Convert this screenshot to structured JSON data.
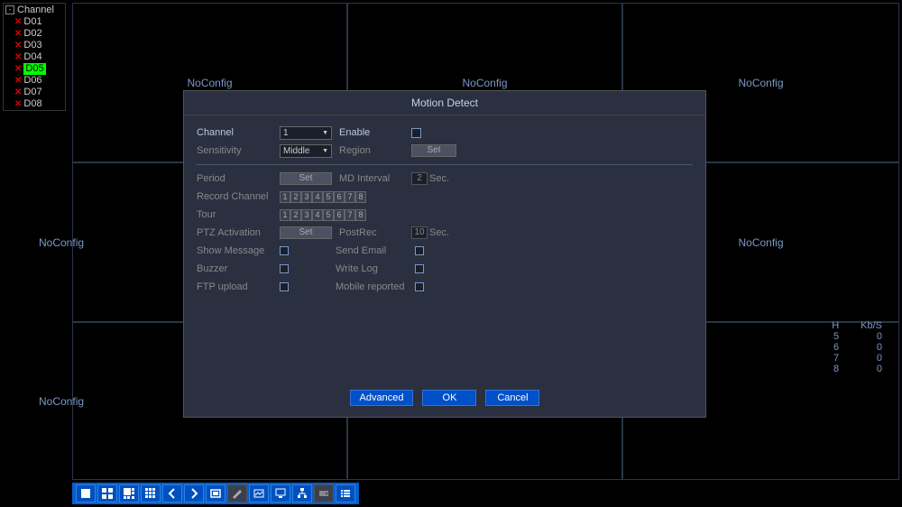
{
  "sidebar": {
    "title": "Channel",
    "items": [
      {
        "label": "D01",
        "selected": false
      },
      {
        "label": "D02",
        "selected": false
      },
      {
        "label": "D03",
        "selected": false
      },
      {
        "label": "D04",
        "selected": false
      },
      {
        "label": "D05",
        "selected": true
      },
      {
        "label": "D06",
        "selected": false
      },
      {
        "label": "D07",
        "selected": false
      },
      {
        "label": "D08",
        "selected": false
      }
    ]
  },
  "grid": {
    "noconfig": "NoConfig"
  },
  "stats": {
    "headers": [
      "H",
      "Kb/S"
    ],
    "rows": [
      {
        "ch": "5",
        "kbps": "0"
      },
      {
        "ch": "6",
        "kbps": "0"
      },
      {
        "ch": "7",
        "kbps": "0"
      },
      {
        "ch": "8",
        "kbps": "0"
      }
    ]
  },
  "dialog": {
    "title": "Motion Detect",
    "labels": {
      "channel": "Channel",
      "enable": "Enable",
      "sensitivity": "Sensitivity",
      "region": "Region",
      "period": "Period",
      "md_interval": "MD Interval",
      "record_channel": "Record Channel",
      "tour": "Tour",
      "ptz_activation": "PTZ Activation",
      "postrec": "PostRec",
      "show_message": "Show Message",
      "send_email": "Send Email",
      "buzzer": "Buzzer",
      "write_log": "Write Log",
      "ftp_upload": "FTP upload",
      "mobile_reported": "Mobile reported",
      "set": "Set",
      "sec": "Sec."
    },
    "values": {
      "channel": "1",
      "sensitivity": "Middle",
      "md_interval": "2",
      "postrec": "10",
      "nums": [
        "1",
        "2",
        "3",
        "4",
        "5",
        "6",
        "7",
        "8"
      ]
    },
    "buttons": {
      "advanced": "Advanced",
      "ok": "OK",
      "cancel": "Cancel"
    }
  }
}
